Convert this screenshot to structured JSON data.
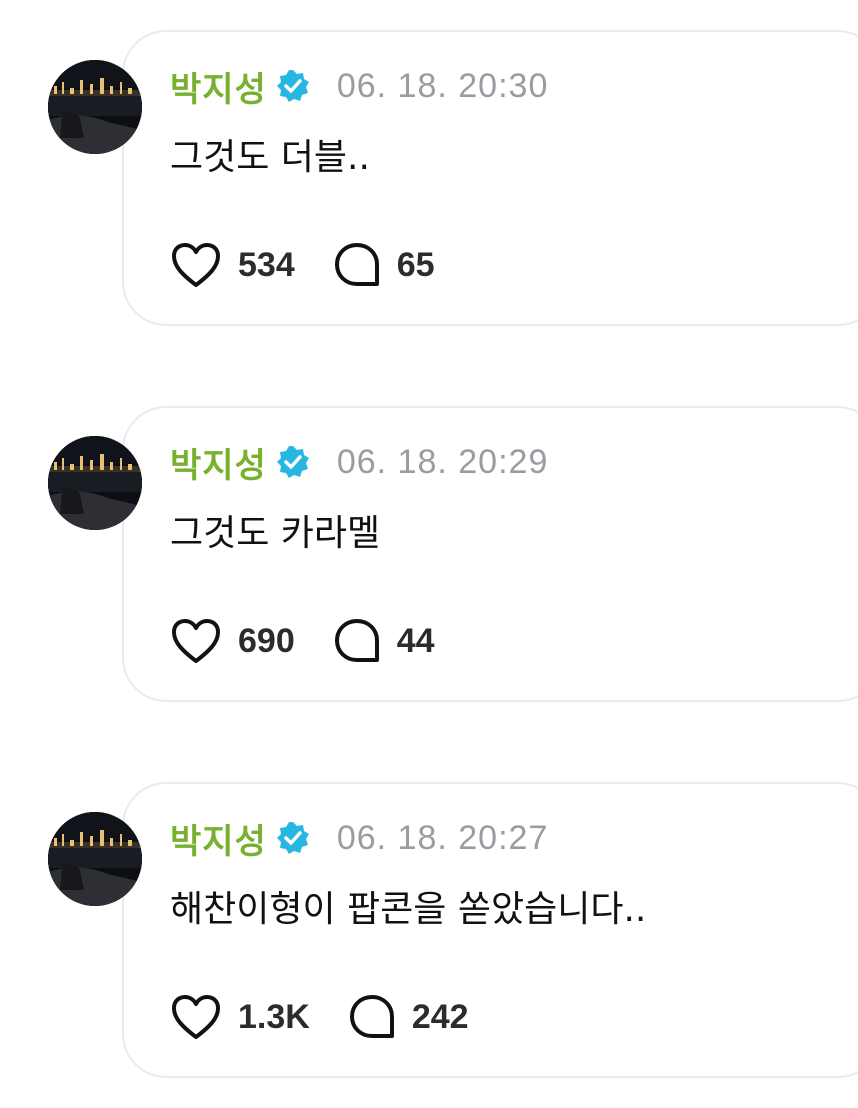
{
  "colors": {
    "name": "#77b12e",
    "badge": "#28b7e3",
    "timestamp": "#9a9ca1",
    "text": "#111111",
    "bubble_border": "#e9ebef"
  },
  "icons": {
    "avatar": "avatar-night-city-photo",
    "verified": "verified-badge-icon",
    "like": "heart-icon",
    "reply": "speech-bubble-icon"
  },
  "posts": [
    {
      "author": "박지성",
      "timestamp": "06. 18. 20:30",
      "message": "그것도 더블..",
      "likes": "534",
      "replies": "65"
    },
    {
      "author": "박지성",
      "timestamp": "06. 18. 20:29",
      "message": "그것도 카라멜",
      "likes": "690",
      "replies": "44"
    },
    {
      "author": "박지성",
      "timestamp": "06. 18. 20:27",
      "message": "해찬이형이 팝콘을 쏟았습니다..",
      "likes": "1.3K",
      "replies": "242"
    }
  ]
}
